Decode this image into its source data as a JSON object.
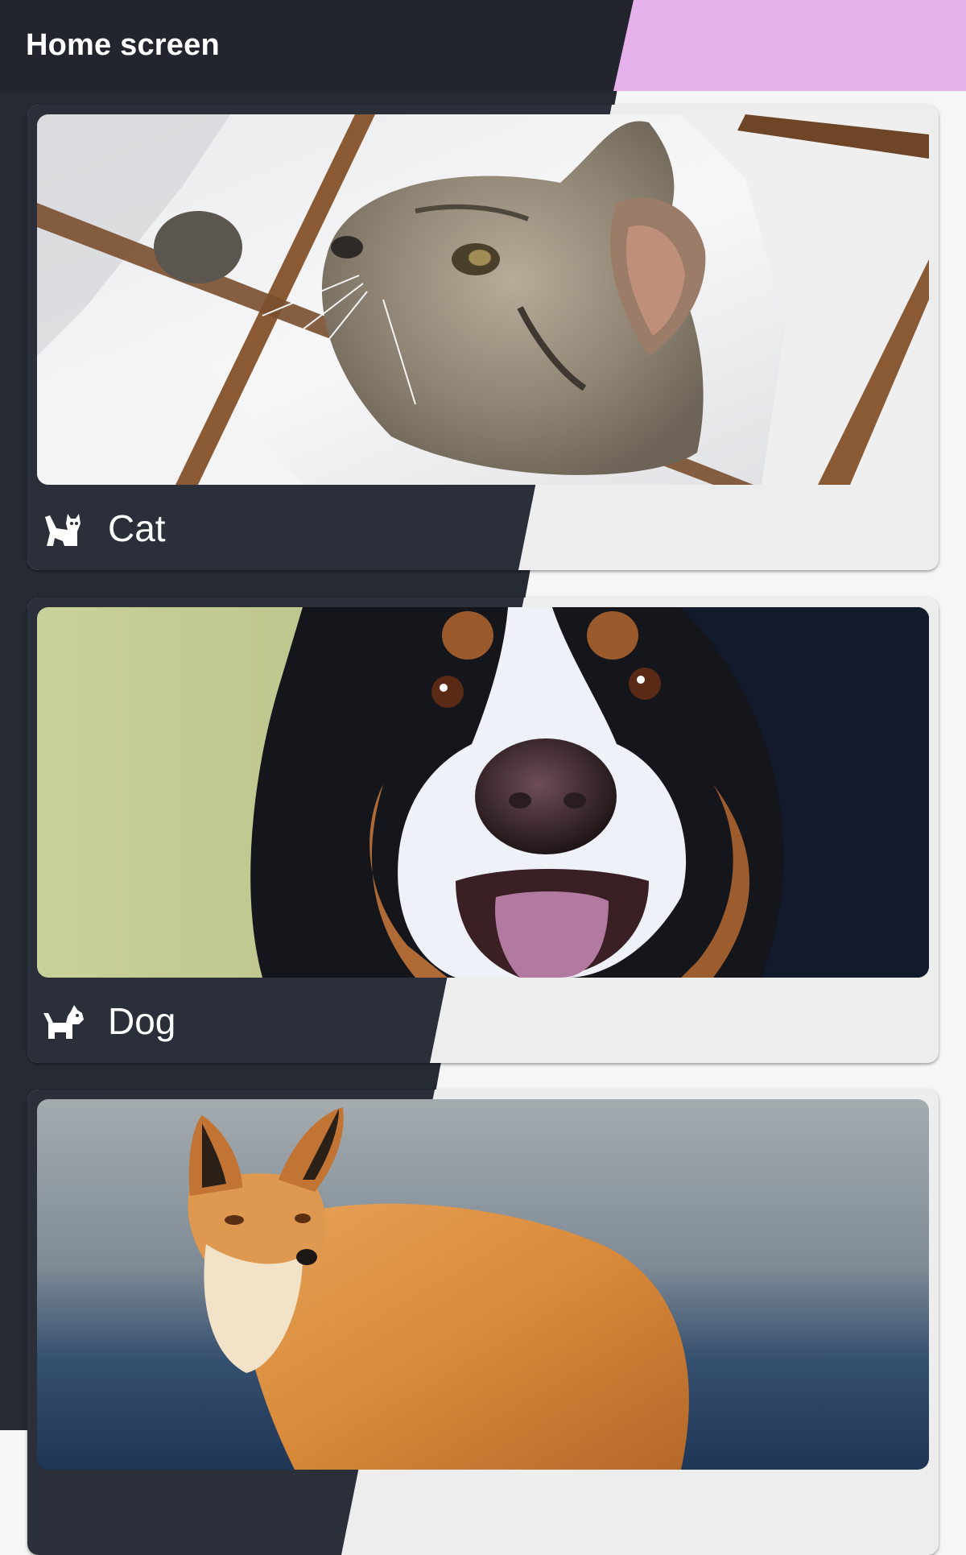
{
  "appbar": {
    "title": "Home screen"
  },
  "colors": {
    "dark_bg": "#262a33",
    "appbar_dark": "#22252d",
    "appbar_accent": "#e6b0ea",
    "card_light": "#ededee",
    "card_dark": "#2b2f3a",
    "page_light": "#f6f6f7"
  },
  "cards": [
    {
      "label": "Cat",
      "icon": "cat-icon"
    },
    {
      "label": "Dog",
      "icon": "dog-icon"
    },
    {
      "label": "",
      "icon": ""
    }
  ]
}
